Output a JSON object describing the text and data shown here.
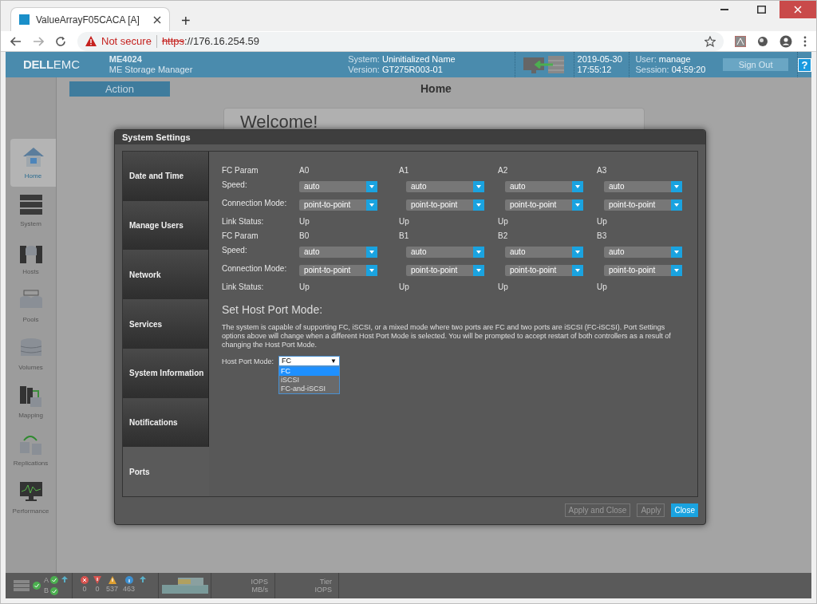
{
  "browser": {
    "tab_title": "ValueArrayF05CACA [A]",
    "new_tab": "+",
    "security": "Not secure",
    "url_scheme": "https",
    "url_rest": "://176.16.254.59"
  },
  "header": {
    "logo_a": "DELL",
    "logo_b": "EMC",
    "product": "ME4024",
    "subtitle": "ME Storage Manager",
    "system_label": "System:",
    "system_value": "Uninitialized Name",
    "version_label": "Version:",
    "version_value": "GT275R003-01",
    "date": "2019-05-30",
    "time": "17:55:12",
    "user_label": "User:",
    "user_value": "manage",
    "session_label": "Session:",
    "session_value": "04:59:20",
    "sign_out": "Sign Out",
    "help": "?"
  },
  "page": {
    "action": "Action",
    "title": "Home",
    "welcome": "Welcome!"
  },
  "nav": [
    {
      "label": "Home",
      "kind": "home",
      "selected": true
    },
    {
      "label": "System",
      "kind": "system",
      "selected": false
    },
    {
      "label": "Hosts",
      "kind": "hosts",
      "selected": false
    },
    {
      "label": "Pools",
      "kind": "pools",
      "selected": false
    },
    {
      "label": "Volumes",
      "kind": "volumes",
      "selected": false
    },
    {
      "label": "Mapping",
      "kind": "mapping",
      "selected": false
    },
    {
      "label": "Replications",
      "kind": "replications",
      "selected": false
    },
    {
      "label": "Performance",
      "kind": "performance",
      "selected": false
    }
  ],
  "modal": {
    "title": "System Settings",
    "tabs": [
      {
        "label": "Date and Time",
        "selected": false
      },
      {
        "label": "Manage Users",
        "selected": false
      },
      {
        "label": "Network",
        "selected": false
      },
      {
        "label": "Services",
        "selected": false
      },
      {
        "label": "System Information",
        "selected": false
      },
      {
        "label": "Notifications",
        "selected": false
      },
      {
        "label": "Ports",
        "selected": true
      }
    ],
    "port_groups": [
      {
        "param": "FC Param",
        "speed": "Speed:",
        "mode": "Connection Mode:",
        "status": "Link Status:",
        "ports": [
          {
            "name": "A0",
            "speed": "auto",
            "mode": "point-to-point",
            "status": "Up"
          },
          {
            "name": "A1",
            "speed": "auto",
            "mode": "point-to-point",
            "status": "Up"
          },
          {
            "name": "A2",
            "speed": "auto",
            "mode": "point-to-point",
            "status": "Up"
          },
          {
            "name": "A3",
            "speed": "auto",
            "mode": "point-to-point",
            "status": "Up"
          }
        ]
      },
      {
        "param": "FC Param",
        "speed": "Speed:",
        "mode": "Connection Mode:",
        "status": "Link Status:",
        "ports": [
          {
            "name": "B0",
            "speed": "auto",
            "mode": "point-to-point",
            "status": "Up"
          },
          {
            "name": "B1",
            "speed": "auto",
            "mode": "point-to-point",
            "status": "Up"
          },
          {
            "name": "B2",
            "speed": "auto",
            "mode": "point-to-point",
            "status": "Up"
          },
          {
            "name": "B3",
            "speed": "auto",
            "mode": "point-to-point",
            "status": "Up"
          }
        ]
      }
    ],
    "host_port": {
      "heading": "Set Host Port Mode:",
      "description": "The system is capable of supporting FC, iSCSI, or a mixed mode where two ports are FC and two ports are iSCSI (FC-iSCSI). Port Settings options above will change when a different Host Port Mode is selected. You will be prompted to accept restart of both controllers as a result of changing the Host Port Mode.",
      "label": "Host Port Mode:",
      "value": "FC",
      "caret": "▼",
      "expanded": true,
      "options": [
        {
          "label": "FC",
          "selected": true
        },
        {
          "label": "iSCSI",
          "selected": false
        },
        {
          "label": "FC-and-iSCSI",
          "selected": false
        }
      ]
    },
    "buttons": [
      {
        "label": "Apply and Close",
        "disabled": true
      },
      {
        "label": "Apply",
        "disabled": true
      },
      {
        "label": "Close",
        "disabled": false
      }
    ]
  },
  "footer": {
    "controllers": [
      "A",
      "B"
    ],
    "alerts": [
      {
        "kind": "error",
        "count": "0"
      },
      {
        "kind": "critical",
        "count": "0"
      },
      {
        "kind": "warning",
        "count": "537"
      },
      {
        "kind": "info",
        "count": "463"
      }
    ],
    "perf_a": [
      "IOPS",
      "MB/s"
    ],
    "perf_b": [
      "Tier",
      "IOPS"
    ]
  }
}
